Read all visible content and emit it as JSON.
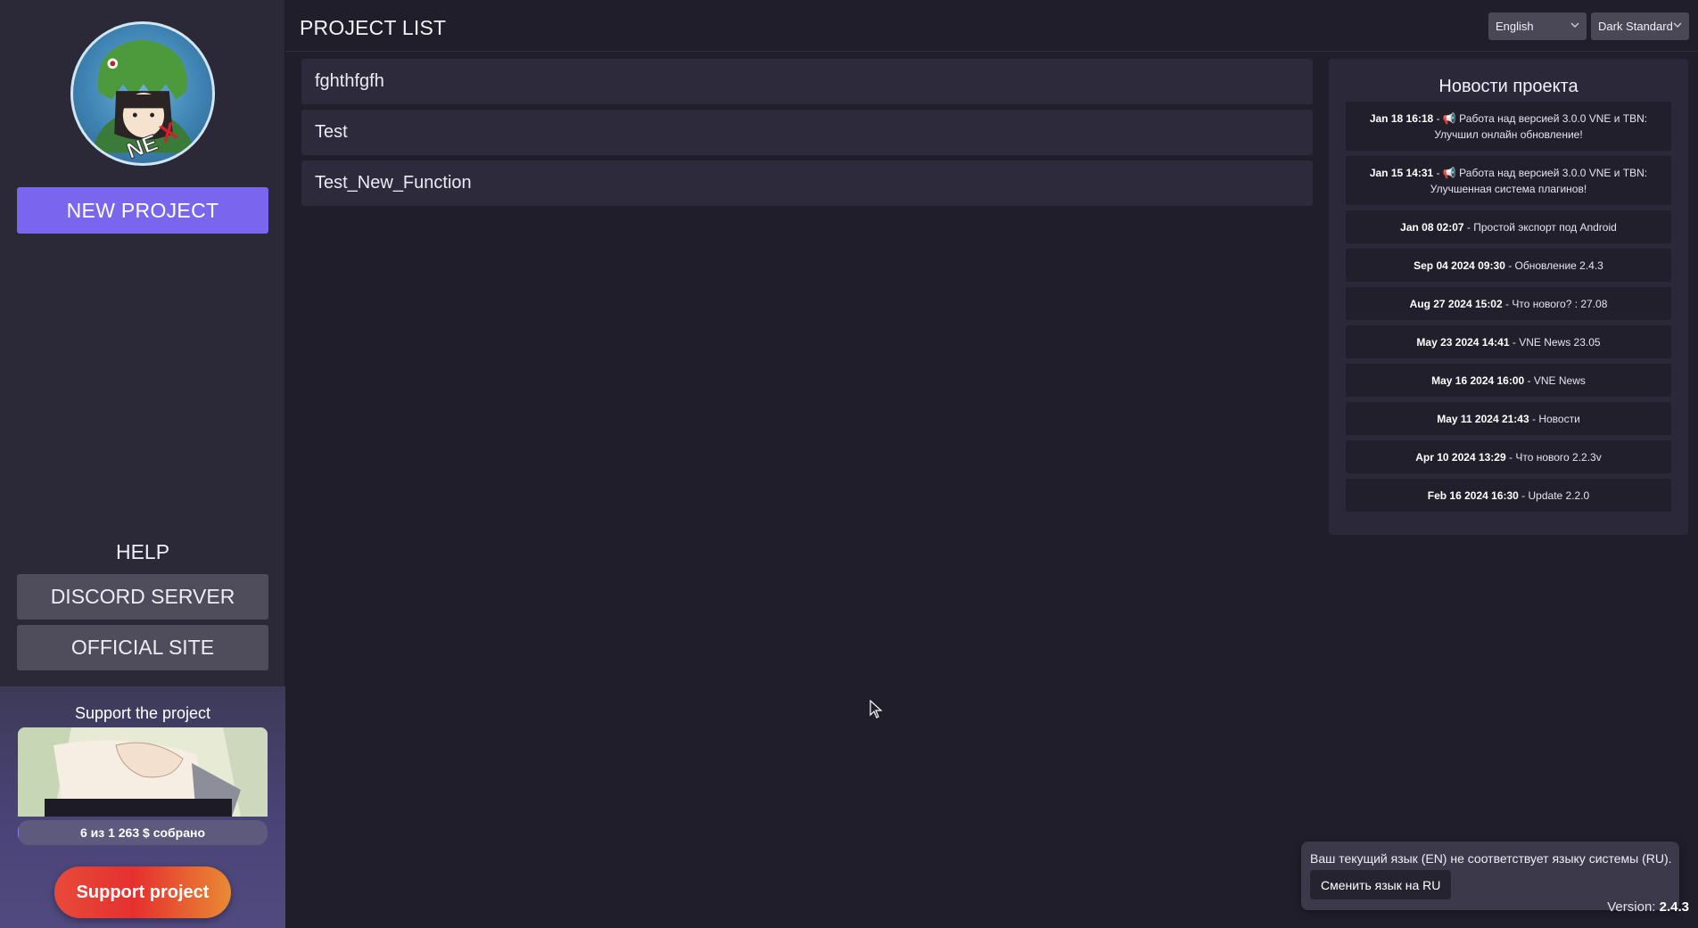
{
  "sidebar": {
    "new_project_label": "NEW PROJECT",
    "help_title": "HELP",
    "discord_label": "DISCORD SERVER",
    "site_label": "OFFICIAL SITE",
    "support": {
      "title": "Support the project",
      "progress_text": "6 из 1 263 $ собрано",
      "progress_fraction": 0.005,
      "button_label": "Support project"
    }
  },
  "header": {
    "title": "PROJECT LIST",
    "language_select": "English",
    "theme_select": "Dark Standard"
  },
  "projects": [
    "fghthfgfh",
    "Test",
    "Test_New_Function"
  ],
  "news": {
    "title": "Новости проекта",
    "items": [
      {
        "date": "Jan 18 16:18",
        "text": "Работа над версией 3.0.0 VNE и TBN: Улучшил онлайн обновление!",
        "pinned": true
      },
      {
        "date": "Jan 15 14:31",
        "text": "Работа над версией 3.0.0 VNE и TBN: Улучшенная система плагинов!",
        "pinned": true
      },
      {
        "date": "Jan 08 02:07",
        "text": "Простой экспорт под Android"
      },
      {
        "date": "Sep 04 2024 09:30",
        "text": "Обновление 2.4.3"
      },
      {
        "date": "Aug 27 2024 15:02",
        "text": "Что нового? : 27.08"
      },
      {
        "date": "May 23 2024 14:41",
        "text": "VNE News 23.05"
      },
      {
        "date": "May 16 2024 16:00",
        "text": "VNE News"
      },
      {
        "date": "May 11 2024 21:43",
        "text": "Новости"
      },
      {
        "date": "Apr 10 2024 13:29",
        "text": "Что нового 2.2.3v"
      },
      {
        "date": "Feb 16 2024 16:30",
        "text": "Update 2.2.0"
      }
    ]
  },
  "toast": {
    "message": "Ваш текущий язык (EN) не соответствует языку системы (RU).",
    "button_label": "Сменить язык на RU"
  },
  "version": {
    "label": "Version:",
    "value": "2.4.3"
  },
  "colors": {
    "accent": "#7a66ee",
    "background": "#211e2c",
    "sidebar": "#2b2838",
    "support_gradient_start": "#e84a3a",
    "support_gradient_end": "#e88a33"
  },
  "icons": [
    "logo-avatar",
    "chevron-down-icon",
    "megaphone-icon",
    "mouse-cursor-icon"
  ]
}
